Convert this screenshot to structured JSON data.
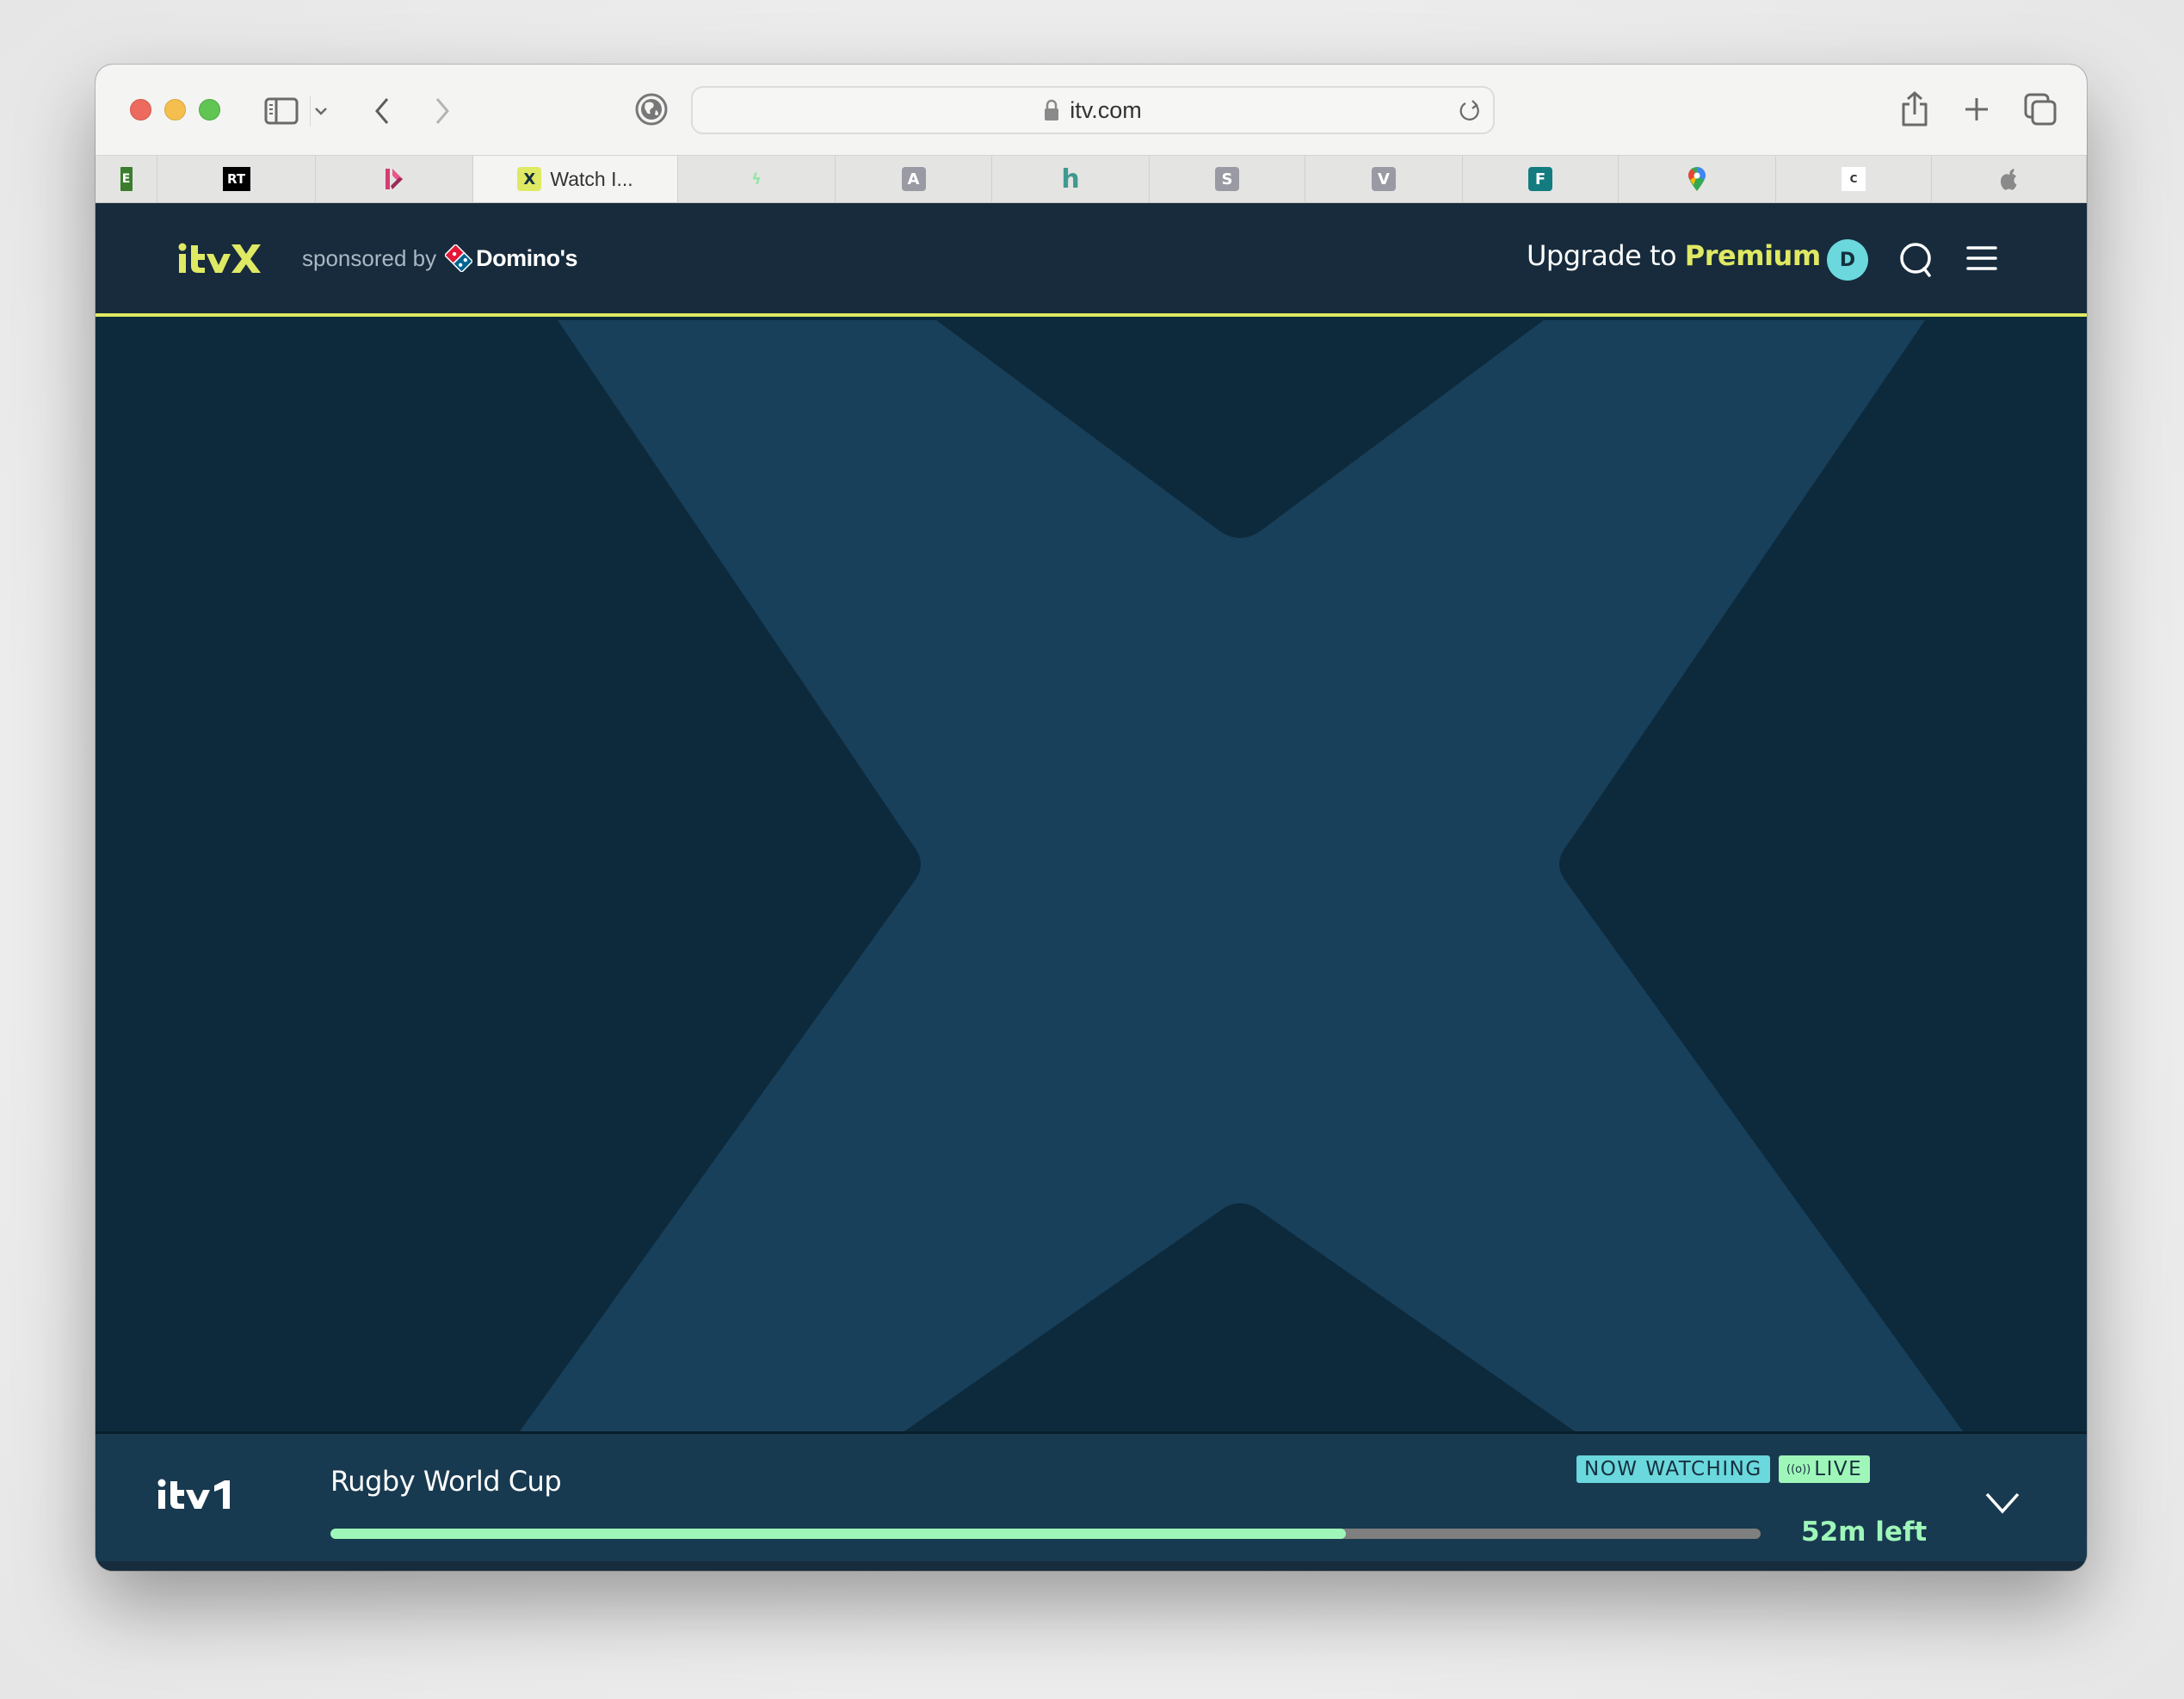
{
  "browser": {
    "url": "itv.com",
    "tabs": [
      {
        "favicon": "E",
        "favicon_name": "e-favicon",
        "favicon_bg": "#ffffff",
        "favicon_fg": "#3a7d2c",
        "title": ""
      },
      {
        "favicon": "RT",
        "favicon_name": "rt-favicon",
        "favicon_bg": "#000000",
        "favicon_fg": "#ffffff",
        "title": ""
      },
      {
        "favicon": "▶",
        "favicon_name": "play-favicon",
        "favicon_bg": "transparent",
        "favicon_fg": "#d63c74",
        "title": ""
      },
      {
        "favicon": "X",
        "favicon_name": "itvx-favicon",
        "favicon_bg": "#dfe963",
        "favicon_fg": "#15303f",
        "title": "Watch I...",
        "active": true
      },
      {
        "favicon": "ϟ",
        "favicon_name": "bolt-favicon",
        "favicon_bg": "transparent",
        "favicon_fg": "#8fe7a6",
        "title": ""
      },
      {
        "favicon": "A",
        "favicon_name": "a-favicon",
        "favicon_bg": "#9a9aa4",
        "favicon_fg": "#ffffff",
        "title": ""
      },
      {
        "favicon": "h",
        "favicon_name": "h-favicon",
        "favicon_bg": "transparent",
        "favicon_fg": "#3f9a90",
        "title": ""
      },
      {
        "favicon": "S",
        "favicon_name": "s-favicon",
        "favicon_bg": "#9a9aa4",
        "favicon_fg": "#ffffff",
        "title": ""
      },
      {
        "favicon": "V",
        "favicon_name": "v-favicon",
        "favicon_bg": "#9a9aa4",
        "favicon_fg": "#ffffff",
        "title": ""
      },
      {
        "favicon": "F",
        "favicon_name": "forms-favicon",
        "favicon_bg": "#137c80",
        "favicon_fg": "#ffffff",
        "title": ""
      },
      {
        "favicon": "●",
        "favicon_name": "maps-favicon",
        "favicon_bg": "transparent",
        "favicon_fg": "#ea4335",
        "title": ""
      },
      {
        "favicon": "C",
        "favicon_name": "conwy-favicon",
        "favicon_bg": "#ffffff",
        "favicon_fg": "#333333",
        "title": ""
      },
      {
        "favicon": "",
        "favicon_name": "apple-favicon",
        "favicon_bg": "transparent",
        "favicon_fg": "#8a8a8a",
        "title": ""
      }
    ]
  },
  "header": {
    "logo": "itvX",
    "sponsored_by": "sponsored by",
    "sponsor": "Domino's",
    "upgrade_prefix": "Upgrade to",
    "upgrade_highlight": "Premium",
    "avatar_initial": "D"
  },
  "now_playing": {
    "channel": "itv1",
    "title": "Rugby World Cup",
    "badge_now": "NOW WATCHING",
    "badge_live": "LIVE",
    "live_icon": "((o))",
    "progress": 0.71,
    "time_left": "52m left"
  },
  "colors": {
    "accent_yellow": "#dfe963",
    "accent_teal": "#6ad8dc",
    "accent_green": "#9ef7b9",
    "nav_bg": "#172b3c",
    "hero_bg": "#0c2a3c",
    "hero_x": "#19405a"
  }
}
